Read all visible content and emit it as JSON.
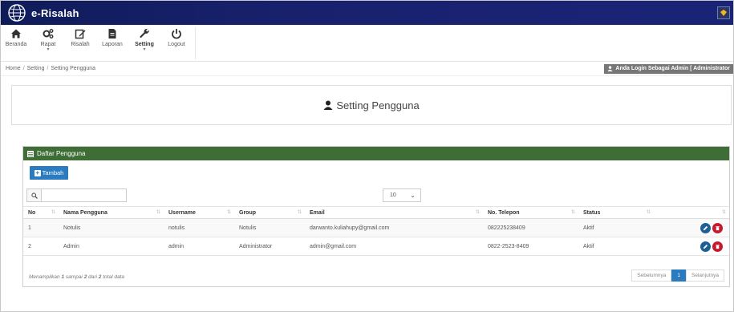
{
  "app": {
    "title": "e-Risalah"
  },
  "toolbar": {
    "items": [
      {
        "label": "Beranda",
        "icon": "home-icon"
      },
      {
        "label": "Rapat",
        "icon": "gears-icon"
      },
      {
        "label": "Risalah",
        "icon": "edit-icon"
      },
      {
        "label": "Laporan",
        "icon": "file-icon"
      },
      {
        "label": "Setting",
        "icon": "wrench-icon"
      },
      {
        "label": "Logout",
        "icon": "power-icon"
      }
    ]
  },
  "breadcrumb": {
    "home": "Home",
    "setting": "Setting",
    "current": "Setting Pengguna"
  },
  "login_badge": "Anda Login Sebagai Admin [ Administrator",
  "page_title": "Setting Pengguna",
  "panel": {
    "title": "Daftar Pengguna",
    "add_label": "Tambah",
    "search_placeholder": "",
    "page_size": "10",
    "columns": [
      "No",
      "Nama Pengguna",
      "Username",
      "Group",
      "Email",
      "No. Telepon",
      "Status",
      ""
    ],
    "rows": [
      [
        "1",
        "Notulis",
        "notulis",
        "Notulis",
        "darwanto.kuliahupy@gmail.com",
        "082225238409",
        "Aktif"
      ],
      [
        "2",
        "Admin",
        "admin",
        "Administrator",
        "admin@gmail.com",
        "0822-2523-8409",
        "Aktif"
      ]
    ],
    "info": {
      "prefix": "Menampilkan",
      "from": "1",
      "mid": "sampai",
      "to": "2",
      "mid2": "dari",
      "total": "2",
      "suffix": "total data"
    },
    "pager": {
      "prev": "Sebelumnya",
      "current": "1",
      "next": "Selanjutnya"
    }
  },
  "colors": {
    "titlebar": "#1a2477",
    "panel_header": "#3e6e35",
    "primary": "#2a7bbf",
    "edit": "#1f5f96",
    "delete": "#c51a2c"
  }
}
